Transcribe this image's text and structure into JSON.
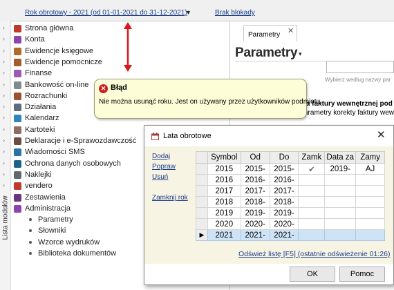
{
  "topbar": {
    "year_label": "Rok obrotowy - 2021  (od 01-01-2021 do 31-12-2021)",
    "year_caret": "▼",
    "lock_label": "Brak blokady"
  },
  "sidebar": {
    "vertical_label": "Lista modułów",
    "items": [
      {
        "label": "Strona główna",
        "icon": "home-icon",
        "color": "#c0392b"
      },
      {
        "label": "Konta",
        "icon": "accounts-icon",
        "color": "#8e44ad"
      },
      {
        "label": "Ewidencje księgowe",
        "icon": "ledger-icon",
        "color": "#b06a2a"
      },
      {
        "label": "Ewidencje pomocnicze",
        "icon": "aux-ledger-icon",
        "color": "#a65b2c"
      },
      {
        "label": "Finanse",
        "icon": "finance-icon",
        "color": "#9b59b6"
      },
      {
        "label": "Bankowość on-line",
        "icon": "bank-icon",
        "color": "#7f8c8d"
      },
      {
        "label": "Rozrachunki",
        "icon": "settlements-icon",
        "color": "#a0522d"
      },
      {
        "label": "Działania",
        "icon": "actions-icon",
        "color": "#5d6d7e"
      },
      {
        "label": "Kalendarz",
        "icon": "calendar-icon",
        "color": "#2e86c1"
      },
      {
        "label": "Kartoteki",
        "icon": "registers-icon",
        "color": "#8d6e63"
      },
      {
        "label": "Deklaracje i e-Sprawozdawczość",
        "icon": "declarations-icon",
        "color": "#6d4c41"
      },
      {
        "label": "Wiadomości SMS",
        "icon": "sms-icon",
        "color": "#2874a6"
      },
      {
        "label": "Ochrona danych osobowych",
        "icon": "data-protection-icon",
        "color": "#1f618d"
      },
      {
        "label": "Naklejki",
        "icon": "labels-icon",
        "color": "#616a6b"
      },
      {
        "label": "vendero",
        "icon": "vendero-icon",
        "color": "#c0392b"
      },
      {
        "label": "Zestawienia",
        "icon": "reports-icon",
        "color": "#6c3483"
      },
      {
        "label": "Administracja",
        "icon": "admin-icon",
        "color": "#8e44ad"
      }
    ],
    "subitems": [
      "Parametry",
      "Słowniki",
      "Wzorce wydruków",
      "Biblioteka dokumentów"
    ]
  },
  "right_panel": {
    "tab_label": "Parametry",
    "tab_close": "✕",
    "title": "Parametry",
    "title_caret": "▾",
    "search_hint": "Wybierz według nazwy par",
    "line1": "la faktury wewnętrznej pod",
    "line2": "arametry korekty faktury wewn"
  },
  "error": {
    "icon_glyph": "✕",
    "title": "Błąd",
    "message": "Nie można usunąć roku. Jest on używany przez użytkowników podmiotu."
  },
  "dialog": {
    "title": "Lata obrotowe",
    "close": "✕",
    "actions": [
      "Dodaj",
      "Popraw",
      "Usuń",
      "Zamknij rok"
    ],
    "columns": [
      "Symbol",
      "Od",
      "Do",
      "Zamk",
      "Data za",
      "Zamy"
    ],
    "rows": [
      {
        "symbol": "2015",
        "od": "2015-",
        "do": "2015-",
        "zamk": "✔",
        "data_za": "2019-",
        "zamy": "AJ"
      },
      {
        "symbol": "2016",
        "od": "2016-",
        "do": "2016-",
        "zamk": "",
        "data_za": "",
        "zamy": ""
      },
      {
        "symbol": "2017",
        "od": "2017-",
        "do": "2017-",
        "zamk": "",
        "data_za": "",
        "zamy": ""
      },
      {
        "symbol": "2018",
        "od": "2018-",
        "do": "2018-",
        "zamk": "",
        "data_za": "",
        "zamy": ""
      },
      {
        "symbol": "2019",
        "od": "2019-",
        "do": "2019-",
        "zamk": "",
        "data_za": "",
        "zamy": ""
      },
      {
        "symbol": "2020",
        "od": "2020-",
        "do": "2020-",
        "zamk": "",
        "data_za": "",
        "zamy": ""
      },
      {
        "symbol": "2021",
        "od": "2021-",
        "do": "2021-",
        "zamk": "",
        "data_za": "",
        "zamy": ""
      }
    ],
    "selected_row_marker": "▶",
    "refresh_label": "Odśwież listę [F5] (ostatnie odświeżenie 01:26)",
    "ok_label": "OK",
    "help_label": "Pomoc"
  },
  "colors": {
    "error_bg": "#fdfdd8",
    "error_icon": "#cc1f1f",
    "arrow": "#e0151b",
    "selected_row": "#cfe3f7",
    "link": "#1a3c8a"
  }
}
